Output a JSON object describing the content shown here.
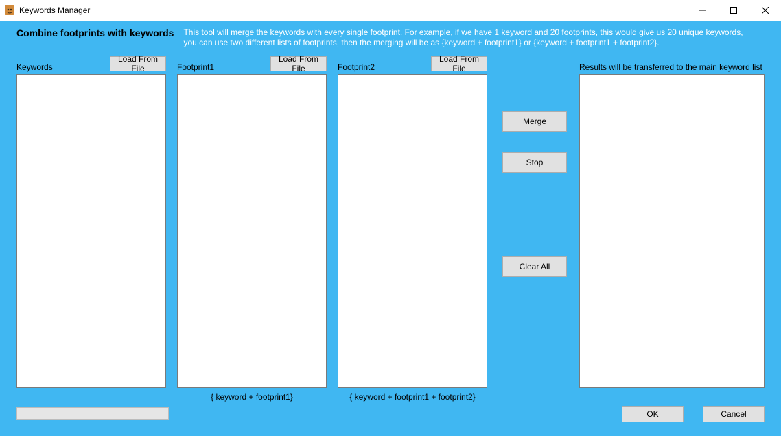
{
  "window": {
    "title": "Keywords Manager"
  },
  "header": {
    "title": "Combine footprints with keywords",
    "description": "This tool will merge the keywords with every single footprint. For example, if we have 1 keyword and 20 footprints, this would give us 20 unique keywords, you can use two different lists of footprints, then the merging will be as {keyword + footprint1} or {keyword + footprint1 + footprint2}."
  },
  "columns": {
    "keywords": {
      "label": "Keywords",
      "load_label": "Load From File",
      "value": ""
    },
    "footprint1": {
      "label": "Footprint1",
      "load_label": "Load From File",
      "value": "",
      "hint": "{ keyword + footprint1}"
    },
    "footprint2": {
      "label": "Footprint2",
      "load_label": "Load From File",
      "value": "",
      "hint": "{ keyword + footprint1 + footprint2}"
    }
  },
  "actions": {
    "merge": "Merge",
    "stop": "Stop",
    "clear_all": "Clear All"
  },
  "results": {
    "label": "Results will be transferred to the main keyword list",
    "value": ""
  },
  "footer": {
    "ok": "OK",
    "cancel": "Cancel"
  }
}
